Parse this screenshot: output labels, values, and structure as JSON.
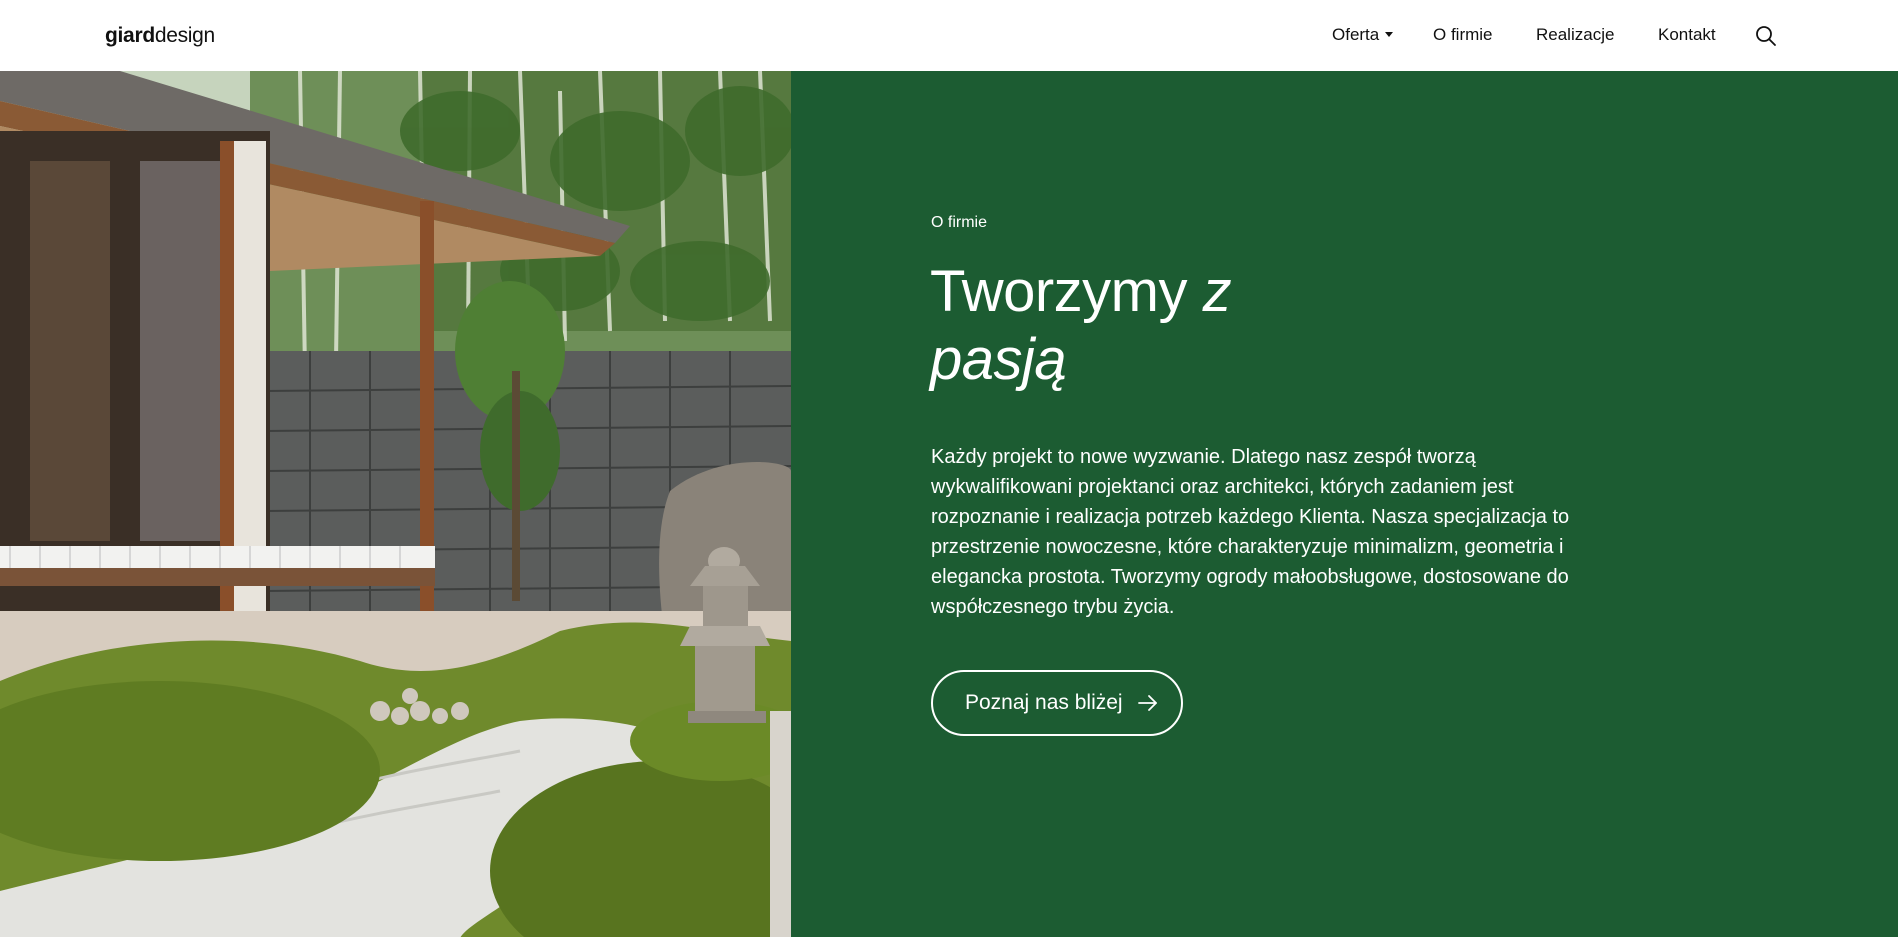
{
  "header": {
    "logo_bold": "giard",
    "logo_light": "design",
    "nav": {
      "oferta": "Oferta",
      "o_firmie": "O firmie",
      "realizacje": "Realizacje",
      "kontakt": "Kontakt"
    },
    "search_icon": "search-icon"
  },
  "hero": {
    "image_description_icon": "photo",
    "eyebrow": "O firmie",
    "headline_line1_plain": "Tworzymy ",
    "headline_line1_italic": "z",
    "headline_line2_italic": "pasją",
    "body": "Każdy projekt to nowe wyzwanie. Dlatego nasz zespół tworzą wykwalifikowani projektanci oraz architekci, których zadaniem jest rozpoznanie i realizacja potrzeb każdego Klienta. Nasza specjalizacja to przestrzenie nowoczesne, które charakteryzuje minimalizm, geometria i elegancka prostota. Tworzymy ogrody małoobsługowe, dostosowane do współczesnego trybu życia.",
    "cta_label": "Poznaj nas bliżej",
    "cta_icon": "arrow-right-icon"
  },
  "colors": {
    "green_panel": "#1c5c32",
    "text_on_green": "#ffffff",
    "header_bg": "#ffffff"
  }
}
